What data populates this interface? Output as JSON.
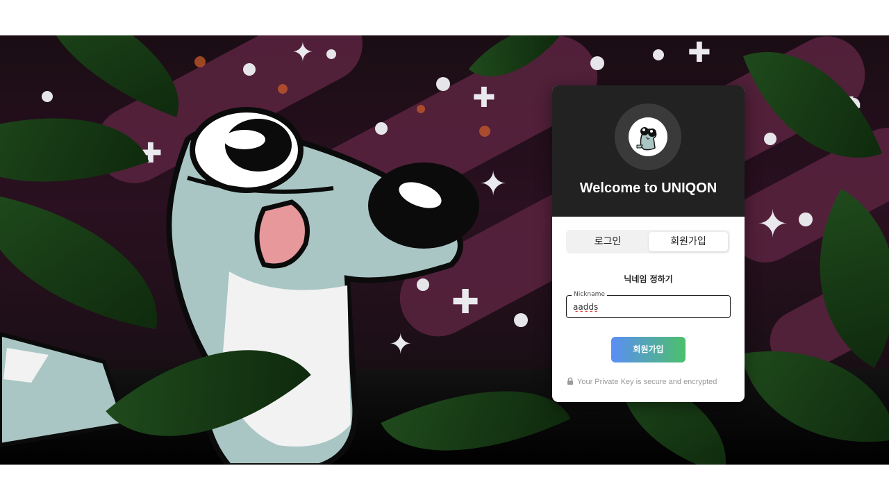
{
  "card": {
    "title": "Welcome to UNIQON",
    "tabs": [
      {
        "label": "로그인",
        "active": false
      },
      {
        "label": "회원가입",
        "active": true
      }
    ],
    "subtitle": "닉네임 정하기",
    "nickname_field": {
      "label": "Nickname",
      "value": "aadds"
    },
    "submit_label": "회원가입",
    "secure_note": "Your Private Key is secure and encrypted"
  },
  "icons": {
    "logo": "frog-mascot-logo",
    "secure": "lock-icon"
  },
  "colors": {
    "card_header": "#222222",
    "button_gradient_start": "#5b8ef5",
    "button_gradient_end": "#4cc06b",
    "background_blob": "#5a2340"
  }
}
